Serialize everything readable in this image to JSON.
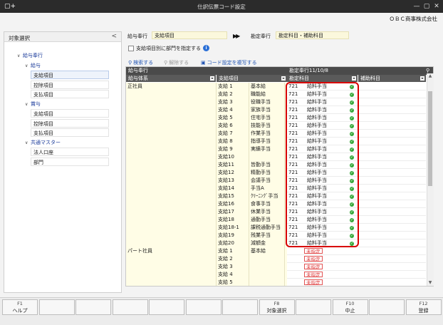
{
  "window": {
    "title": "仕訳伝票コード設定",
    "company": "ＯＢＣ商事株式会社"
  },
  "sidebar": {
    "title": "対象選択",
    "tree": [
      {
        "label": "給与奉行",
        "level": 0,
        "expanded": true,
        "group": true
      },
      {
        "label": "給与",
        "level": 1,
        "expanded": true,
        "group": true
      },
      {
        "label": "支給項目",
        "level": 2,
        "selected": true
      },
      {
        "label": "控除項目",
        "level": 2
      },
      {
        "label": "支払項目",
        "level": 2
      },
      {
        "label": "賞与",
        "level": 1,
        "expanded": true,
        "group": true
      },
      {
        "label": "支給項目",
        "level": 2
      },
      {
        "label": "控除項目",
        "level": 2
      },
      {
        "label": "支払項目",
        "level": 2
      },
      {
        "label": "共通マスター",
        "level": 1,
        "expanded": true,
        "group": true
      },
      {
        "label": "法人口座",
        "level": 2
      },
      {
        "label": "部門",
        "level": 2
      }
    ]
  },
  "form": {
    "source_label": "給与奉行",
    "source_value": "支給項目",
    "target_label": "勘定奉行",
    "target_value": "勘定科目・補助科目",
    "checkbox_label": "支給項目別に部門を指定する"
  },
  "toolbar": {
    "search": "検索する",
    "clear": "解除する",
    "copy": "コード設定を複写する"
  },
  "grid": {
    "left_header": "給与奉行",
    "right_header": "勘定奉行11/10/8",
    "columns": [
      "給与体系",
      "支給項目",
      "勘定科目",
      "補助科目"
    ],
    "rows": [
      {
        "sys": "正社員",
        "item": "支給 1",
        "name": "基本給",
        "code": "721",
        "acct": "給料手当",
        "ok": true
      },
      {
        "sys": "",
        "item": "支給 2",
        "name": "職能給",
        "code": "721",
        "acct": "給料手当",
        "ok": true
      },
      {
        "sys": "",
        "item": "支給 3",
        "name": "役職手当",
        "code": "721",
        "acct": "給料手当",
        "ok": true
      },
      {
        "sys": "",
        "item": "支給 4",
        "name": "家族手当",
        "code": "721",
        "acct": "給料手当",
        "ok": true
      },
      {
        "sys": "",
        "item": "支給 5",
        "name": "住宅手当",
        "code": "721",
        "acct": "給料手当",
        "ok": true
      },
      {
        "sys": "",
        "item": "支給 6",
        "name": "技能手当",
        "code": "721",
        "acct": "給料手当",
        "ok": true
      },
      {
        "sys": "",
        "item": "支給 7",
        "name": "作業手当",
        "code": "721",
        "acct": "給料手当",
        "ok": true
      },
      {
        "sys": "",
        "item": "支給 8",
        "name": "指導手当",
        "code": "721",
        "acct": "給料手当",
        "ok": true
      },
      {
        "sys": "",
        "item": "支給 9",
        "name": "実績手当",
        "code": "721",
        "acct": "給料手当",
        "ok": true
      },
      {
        "sys": "",
        "item": "支給10",
        "name": "",
        "code": "721",
        "acct": "給料手当",
        "ok": true
      },
      {
        "sys": "",
        "item": "支給11",
        "name": "皆勤手当",
        "code": "721",
        "acct": "給料手当",
        "ok": true
      },
      {
        "sys": "",
        "item": "支給12",
        "name": "精勤手当",
        "code": "721",
        "acct": "給料手当",
        "ok": true
      },
      {
        "sys": "",
        "item": "支給13",
        "name": "会議手当",
        "code": "721",
        "acct": "給料手当",
        "ok": true
      },
      {
        "sys": "",
        "item": "支給14",
        "name": "手当A",
        "code": "721",
        "acct": "給料手当",
        "ok": true
      },
      {
        "sys": "",
        "item": "支給15",
        "name": "ｸﾘｰﾆﾝｸﾞ手当",
        "code": "721",
        "acct": "給料手当",
        "ok": true
      },
      {
        "sys": "",
        "item": "支給16",
        "name": "食事手当",
        "code": "721",
        "acct": "給料手当",
        "ok": true
      },
      {
        "sys": "",
        "item": "支給17",
        "name": "休業手当",
        "code": "721",
        "acct": "給料手当",
        "ok": true
      },
      {
        "sys": "",
        "item": "支給18",
        "name": "通勤手当",
        "code": "721",
        "acct": "給料手当",
        "ok": true
      },
      {
        "sys": "",
        "item": "支給18-1",
        "name": "課税通勤手当",
        "code": "721",
        "acct": "給料手当",
        "ok": true
      },
      {
        "sys": "",
        "item": "支給19",
        "name": "残業手当",
        "code": "721",
        "acct": "給料手当",
        "ok": true
      },
      {
        "sys": "",
        "item": "支給20",
        "name": "減額金",
        "code": "721",
        "acct": "給料手当",
        "ok": true
      },
      {
        "sys": "パート社員",
        "item": "支給 1",
        "name": "基本給",
        "unset": "未指定"
      },
      {
        "sys": "",
        "item": "支給 2",
        "name": "",
        "unset": "未指定"
      },
      {
        "sys": "",
        "item": "支給 3",
        "name": "",
        "unset": "未指定"
      },
      {
        "sys": "",
        "item": "支給 4",
        "name": "",
        "unset": "未指定"
      },
      {
        "sys": "",
        "item": "支給 5",
        "name": "",
        "unset": "未指定"
      }
    ]
  },
  "fkeys": [
    {
      "key": "F1",
      "label": "ヘルプ"
    },
    {
      "key": "",
      "label": ""
    },
    {
      "key": "",
      "label": ""
    },
    {
      "key": "",
      "label": ""
    },
    {
      "key": "",
      "label": ""
    },
    {
      "key": "",
      "label": ""
    },
    {
      "key": "",
      "label": ""
    },
    {
      "key": "F8",
      "label": "対象選択"
    },
    {
      "key": "",
      "label": ""
    },
    {
      "key": "F10",
      "label": "中止"
    },
    {
      "key": "",
      "label": ""
    },
    {
      "key": "F12",
      "label": "登録"
    }
  ]
}
